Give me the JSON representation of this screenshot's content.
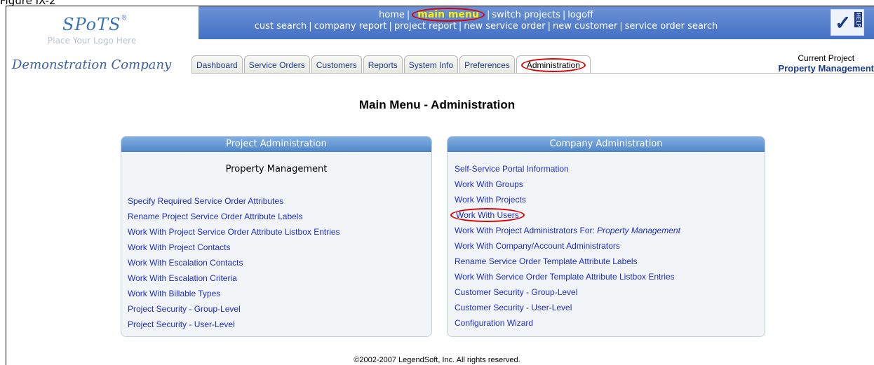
{
  "figure_label": "Figure IX-2",
  "logo": {
    "text": "SPoTS",
    "mark": "®",
    "placeholder": "Place Your Logo Here"
  },
  "nav": {
    "row1": [
      "home",
      "main menu",
      "switch projects",
      "logoff"
    ],
    "row2": [
      "cust search",
      "company report",
      "project report",
      "new service order",
      "new customer",
      "service order search"
    ],
    "highlighted": "main menu",
    "separator": "|"
  },
  "help_icon": {
    "text": "HELP",
    "icon": "checkmark-help-icon"
  },
  "company_name": "Demonstration Company",
  "tabs": [
    "Dashboard",
    "Service Orders",
    "Customers",
    "Reports",
    "System Info",
    "Preferences",
    "Administration"
  ],
  "active_tab": "Administration",
  "current_project": {
    "label": "Current Project",
    "value": "Property Management"
  },
  "page_title": "Main Menu - Administration",
  "project_admin": {
    "heading": "Project Administration",
    "project_name": "Property Management",
    "links": [
      "Specify Required Service Order Attributes",
      "Rename Project Service Order Attribute Labels",
      "Work With Project Service Order Attribute Listbox Entries",
      "Work With Project Contacts",
      "Work With Escalation Contacts",
      "Work With Escalation Criteria",
      "Work With Billable Types",
      "Project Security - Group-Level",
      "Project Security - User-Level"
    ]
  },
  "company_admin": {
    "heading": "Company Administration",
    "links": [
      "Self-Service Portal Information",
      "Work With Groups",
      "Work With Projects",
      "Work With Users",
      "Work With Project Administrators For:",
      "Work With Company/Account Administrators",
      "Rename Service Order Template Attribute Labels",
      "Work With Service Order Template Attribute Listbox Entries",
      "Customer Security - Group-Level",
      "Customer Security - User-Level",
      "Configuration Wizard"
    ],
    "project_admin_for": "Property Management",
    "circled_link": "Work With Users"
  },
  "footer": "©2002-2007 LegendSoft, Inc. All rights reserved.",
  "colors": {
    "nav_band": "#4f7bd0",
    "link": "#1f2dd0",
    "panel_head": "#5b8fd0",
    "highlight_ring": "#dd0000"
  }
}
